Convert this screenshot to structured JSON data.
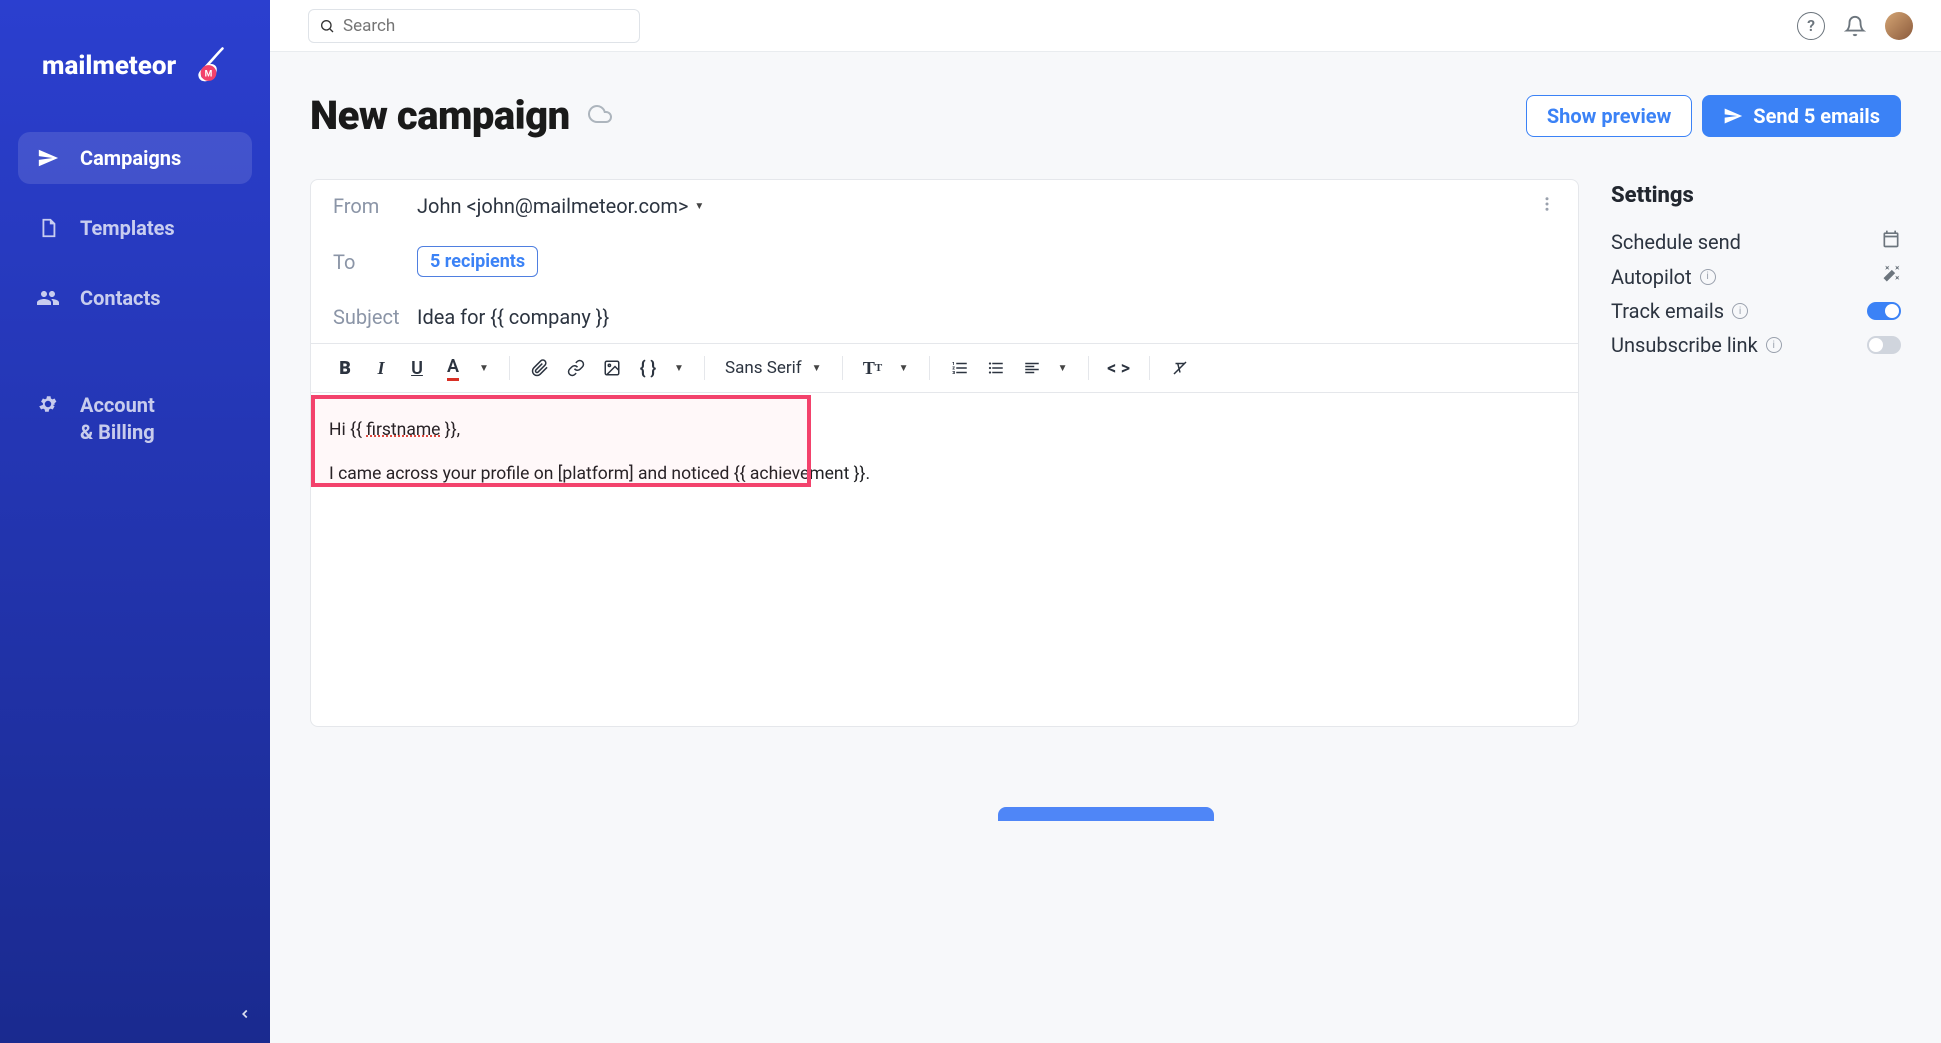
{
  "brand": {
    "name": "mailmeteor"
  },
  "sidebar": {
    "items": [
      {
        "label": "Campaigns",
        "active": true
      },
      {
        "label": "Templates"
      },
      {
        "label": "Contacts"
      },
      {
        "label_line1": "Account",
        "label_line2": "& Billing"
      }
    ]
  },
  "topbar": {
    "search_placeholder": "Search"
  },
  "header": {
    "title": "New campaign",
    "show_preview": "Show preview",
    "send_label": "Send 5 emails"
  },
  "composer": {
    "from_label": "From",
    "from_value": "John <john@mailmeteor.com>",
    "to_label": "To",
    "recipients_badge": "5 recipients",
    "subject_label": "Subject",
    "subject_value": "Idea for {{ company }}",
    "font_family": "Sans Serif",
    "body_line1_pre": "Hi {{ ",
    "body_line1_var": "firstname",
    "body_line1_post": " }},",
    "body_line2": "I came across your profile on [platform] and noticed {{ achievement }}."
  },
  "settings": {
    "title": "Settings",
    "schedule": "Schedule send",
    "autopilot": "Autopilot",
    "track": "Track emails",
    "unsubscribe": "Unsubscribe link",
    "track_on": true,
    "unsubscribe_on": false
  }
}
